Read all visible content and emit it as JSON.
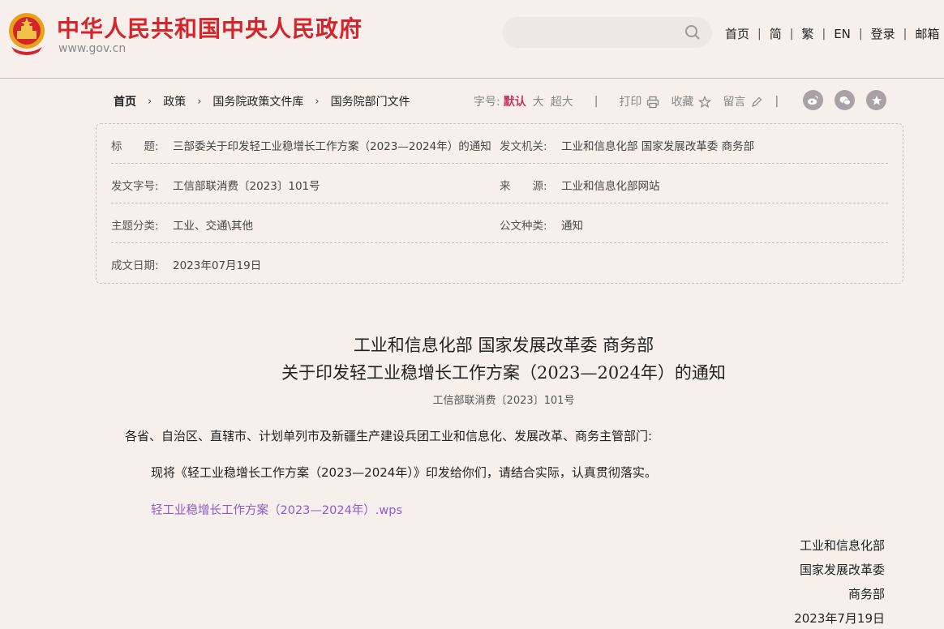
{
  "header": {
    "site_title": "中华人民共和国中央人民政府",
    "site_url": "www.gov.cn",
    "search_placeholder": "",
    "nav": [
      "首页",
      "简",
      "繁",
      "EN",
      "登录",
      "邮箱"
    ]
  },
  "breadcrumb": [
    "首页",
    "政策",
    "国务院政策文件库",
    "国务院部门文件"
  ],
  "toolbar": {
    "font_label": "字号:",
    "font_default": "默认",
    "font_large": "大",
    "font_xlarge": "超大",
    "print": "打印",
    "favorite": "收藏",
    "comment": "留言"
  },
  "info": {
    "title_label": "标　　题:",
    "title_value": "三部委关于印发轻工业稳增长工作方案（2023—2024年）的通知",
    "issuer_label": "发文机关:",
    "issuer_value": "工业和信息化部 国家发展改革委 商务部",
    "doc_no_label": "发文字号:",
    "doc_no_value": "工信部联消费〔2023〕101号",
    "source_label": "来　　源:",
    "source_value": "工业和信息化部网站",
    "category_label": "主题分类:",
    "category_value": "工业、交通\\其他",
    "type_label": "公文种类:",
    "type_value": "通知",
    "date_label": "成文日期:",
    "date_value": "2023年07月19日"
  },
  "document": {
    "title_line1": "工业和信息化部 国家发展改革委 商务部",
    "title_line2": "关于印发轻工业稳增长工作方案（2023—2024年）的通知",
    "doc_no": "工信部联消费〔2023〕101号",
    "salutation": "各省、自治区、直辖市、计划单列市及新疆生产建设兵团工业和信息化、发展改革、商务主管部门:",
    "body": "现将《轻工业稳增长工作方案（2023—2024年）》印发给你们，请结合实际，认真贯彻落实。",
    "attachment": "轻工业稳增长工作方案（2023—2024年）.wps",
    "signatures": [
      "工业和信息化部",
      "国家发展改革委",
      "商务部",
      "2023年7月19日"
    ]
  },
  "colors": {
    "brand_red": "#d4252b",
    "link_purple": "#8e5bc9",
    "accent": "#c0395e",
    "background": "#f6efec"
  }
}
